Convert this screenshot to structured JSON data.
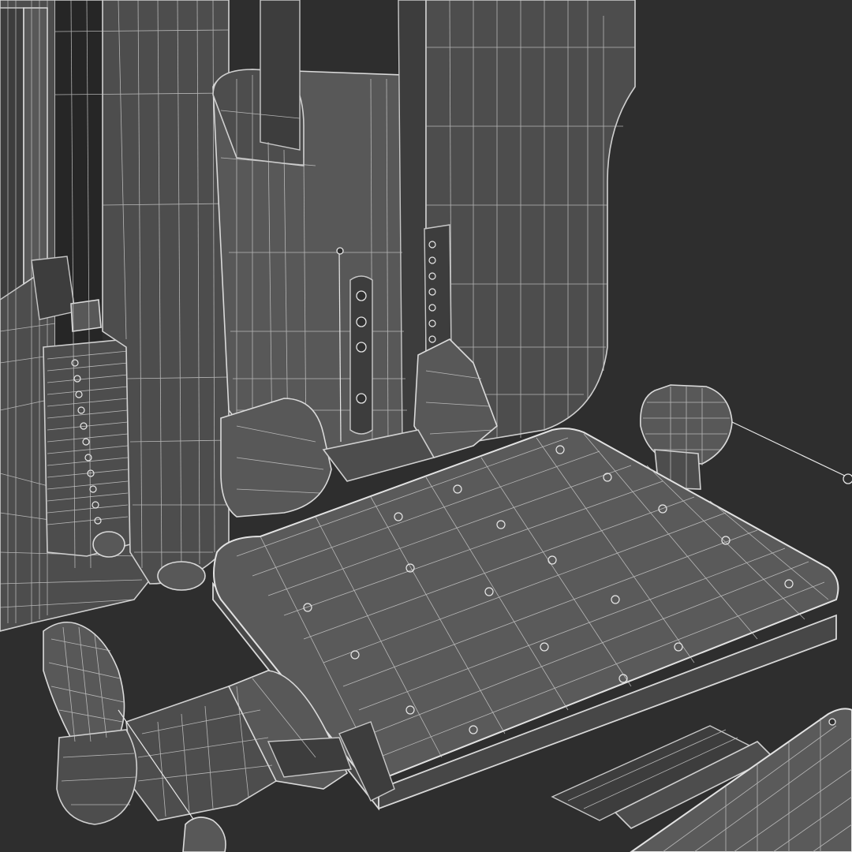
{
  "scene": {
    "subject": "wireframe-render-gym-weight-machine",
    "background_color": "#2e2e2e",
    "mesh_fill_color": "#4d4d4d",
    "wire_color": "#d0d0d0",
    "render_style": "wireframe-on-shaded"
  }
}
